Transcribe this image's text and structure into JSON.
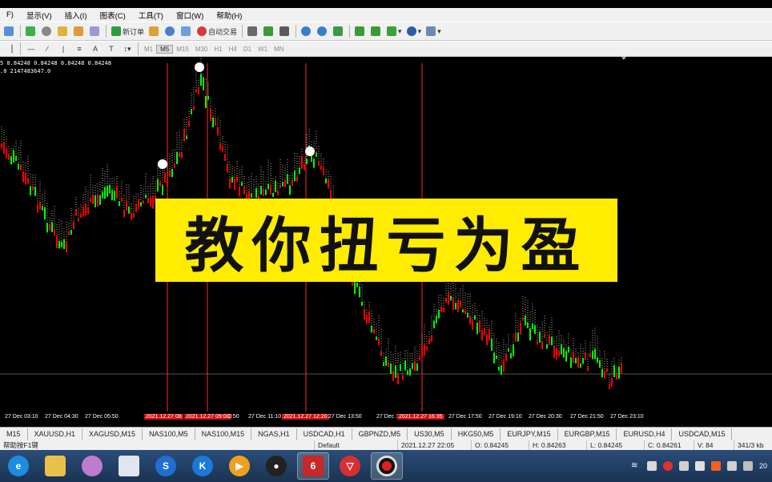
{
  "menubar": {
    "items": [
      "F)",
      "显示(V)",
      "插入(I)",
      "图表(C)",
      "工具(T)",
      "窗口(W)",
      "帮助(H)"
    ]
  },
  "toolbar": {
    "new_order_label": "新订单",
    "auto_trading_label": "自动交易",
    "timeframes": [
      "M1",
      "M5",
      "M15",
      "M30",
      "H1",
      "H4",
      "D1",
      "W1",
      "MN"
    ],
    "active_timeframe": "M5"
  },
  "chart": {
    "info_line1": "5  0.84248 0.84248 0.84248 0.84248",
    "info_line2": ".0  2147483647.0",
    "colors": {
      "bull": "#00ff00",
      "bear": "#ff0000",
      "band": "#f5e4c6",
      "marker": "#ff2a2a"
    },
    "time_labels": [
      "27 Dec 03:10",
      "27 Dec 04:30",
      "27 Dec 05:50",
      "2021.12.27 08",
      "2021.12.27 09:00",
      "0:50",
      "27 Dec 11:10",
      "2021.12.27 12:20",
      "27 Dec 13:50",
      "27 Dec 15:",
      "2021.12.27 16:35",
      "27 Dec 17:50",
      "27 Dec 19:10",
      "27 Dec 20:30",
      "27 Dec 21:50",
      "27 Dec 23:10"
    ]
  },
  "overlay": {
    "text": "教你扭亏为盈"
  },
  "symbol_tabs": [
    "M15",
    "XAUUSD,H1",
    "XAGUSD,M15",
    "NAS100,M5",
    "NAS100,M15",
    "NGAS,H1",
    "USDCAD,H1",
    "GBPNZD,M5",
    "US30,M5",
    "HKG50,M5",
    "EURJPY,M15",
    "EURGBP,M15",
    "EURUSD,H4",
    "USDCAD,M15"
  ],
  "status": {
    "help": "帮助按F1键",
    "profile": "Default",
    "datetime": "2021.12.27 22:05",
    "open": "O: 0.84245",
    "high": "H: 0.84263",
    "low": "L: 0.84245",
    "close": "C: 0.84261",
    "volume": "V: 84",
    "traffic": "341/3 kb"
  },
  "taskbar": {
    "clock": "20"
  }
}
